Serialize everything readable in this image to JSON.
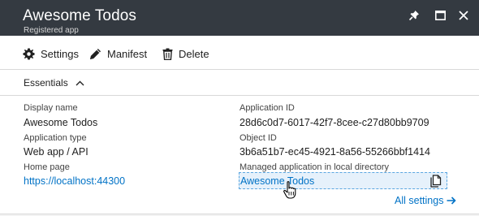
{
  "window": {
    "title": "Awesome Todos",
    "subtitle": "Registered app",
    "controls": [
      "pin-icon",
      "maximize-icon",
      "close-icon"
    ]
  },
  "toolbar": {
    "settings_label": "Settings",
    "manifest_label": "Manifest",
    "delete_label": "Delete"
  },
  "essentials": {
    "label": "Essentials",
    "expanded": true
  },
  "fields": {
    "display_name": {
      "label": "Display name",
      "value": "Awesome Todos"
    },
    "application_type": {
      "label": "Application type",
      "value": "Web app / API"
    },
    "home_page": {
      "label": "Home page",
      "value": "https://localhost:44300"
    },
    "application_id": {
      "label": "Application ID",
      "value": "28d6c0d7-6017-42f7-8cee-c27d80bb9709"
    },
    "object_id": {
      "label": "Object ID",
      "value": "3b6a51b7-ec45-4921-8a56-55266bbf1414"
    },
    "managed_app": {
      "label": "Managed application in local directory",
      "value": "Awesome Todos"
    }
  },
  "all_settings_label": "All settings",
  "colors": {
    "titlebar": "#343a41",
    "link": "#0072c6",
    "highlight": "#e6f1fb"
  }
}
